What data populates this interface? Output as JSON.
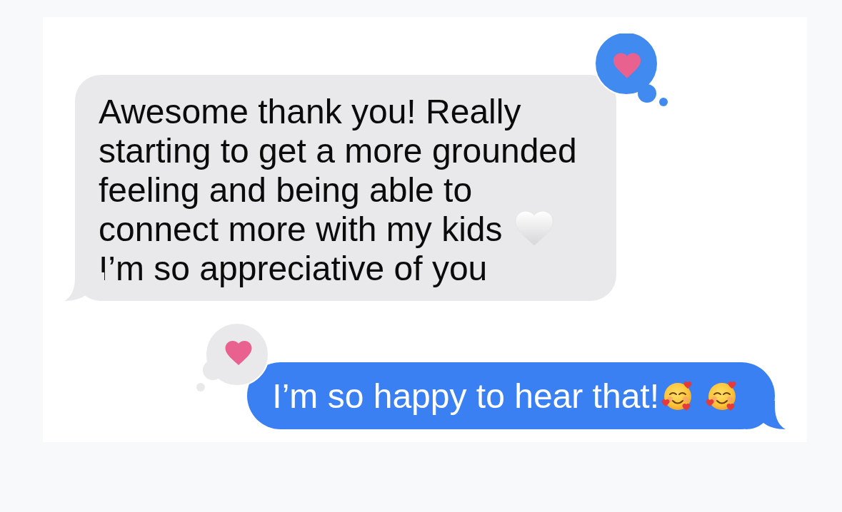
{
  "messages": [
    {
      "kind": "received",
      "paragraphs": [
        [
          "Awesome thank you! Really",
          "starting to get a more grounded",
          "feeling and being able to",
          "connect more with my kids"
        ],
        [
          "I’m so appreciative of you"
        ]
      ],
      "reaction": {
        "from_me": true
      }
    },
    {
      "kind": "sent",
      "text": "I’m so happy to hear that!",
      "reaction": {
        "from_me": false
      }
    }
  ]
}
